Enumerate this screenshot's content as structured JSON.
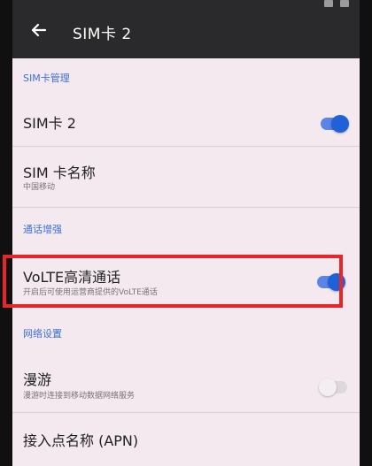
{
  "header": {
    "title": "SIM卡 2",
    "back_icon": "arrow-left-icon"
  },
  "sections": {
    "sim_management": "SIM卡管理",
    "call_enhance": "通话增强",
    "network": "网络设置"
  },
  "rows": {
    "sim2": {
      "title": "SIM卡 2",
      "toggle_on": true
    },
    "sim_name": {
      "title": "SIM 卡名称",
      "subtitle": "中国移动"
    },
    "volte": {
      "title": "VoLTE高清通话",
      "subtitle": "开启后可使用运营商提供的VoLTE通话",
      "toggle_on": true
    },
    "roaming": {
      "title": "漫游",
      "subtitle": "漫游时连接到移动数据网络服务",
      "toggle_on": false
    },
    "apn": {
      "title": "接入点名称 (APN)"
    }
  },
  "colors": {
    "accent": "#1f62d8",
    "section_header": "#3f6fd6",
    "highlight": "#e8262a",
    "appbar": "#2a2a2c"
  }
}
